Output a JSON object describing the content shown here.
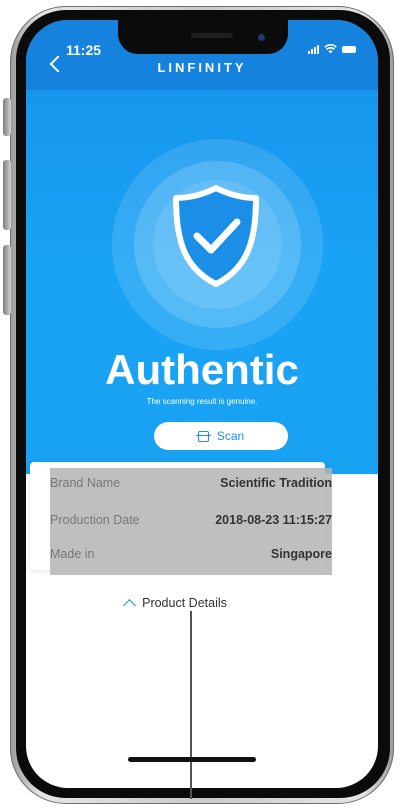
{
  "status_bar": {
    "time": "11:25"
  },
  "header": {
    "title": "LINFINITY"
  },
  "result": {
    "status": "Authentic",
    "message": "The scanning result is genuine.",
    "scan_label": "Scan"
  },
  "details": {
    "rows": [
      {
        "label": "Brand Name",
        "value": "Scientific Tradition"
      },
      {
        "label": "Production Date",
        "value": "2018-08-23 11:15:27"
      },
      {
        "label": "Made in",
        "value": "Singapore"
      }
    ],
    "toggle_label": "Product Details"
  },
  "colors": {
    "accent": "#1c8fe6",
    "header_bg": "#1582de",
    "hero_bg": "#1aa3f5"
  }
}
